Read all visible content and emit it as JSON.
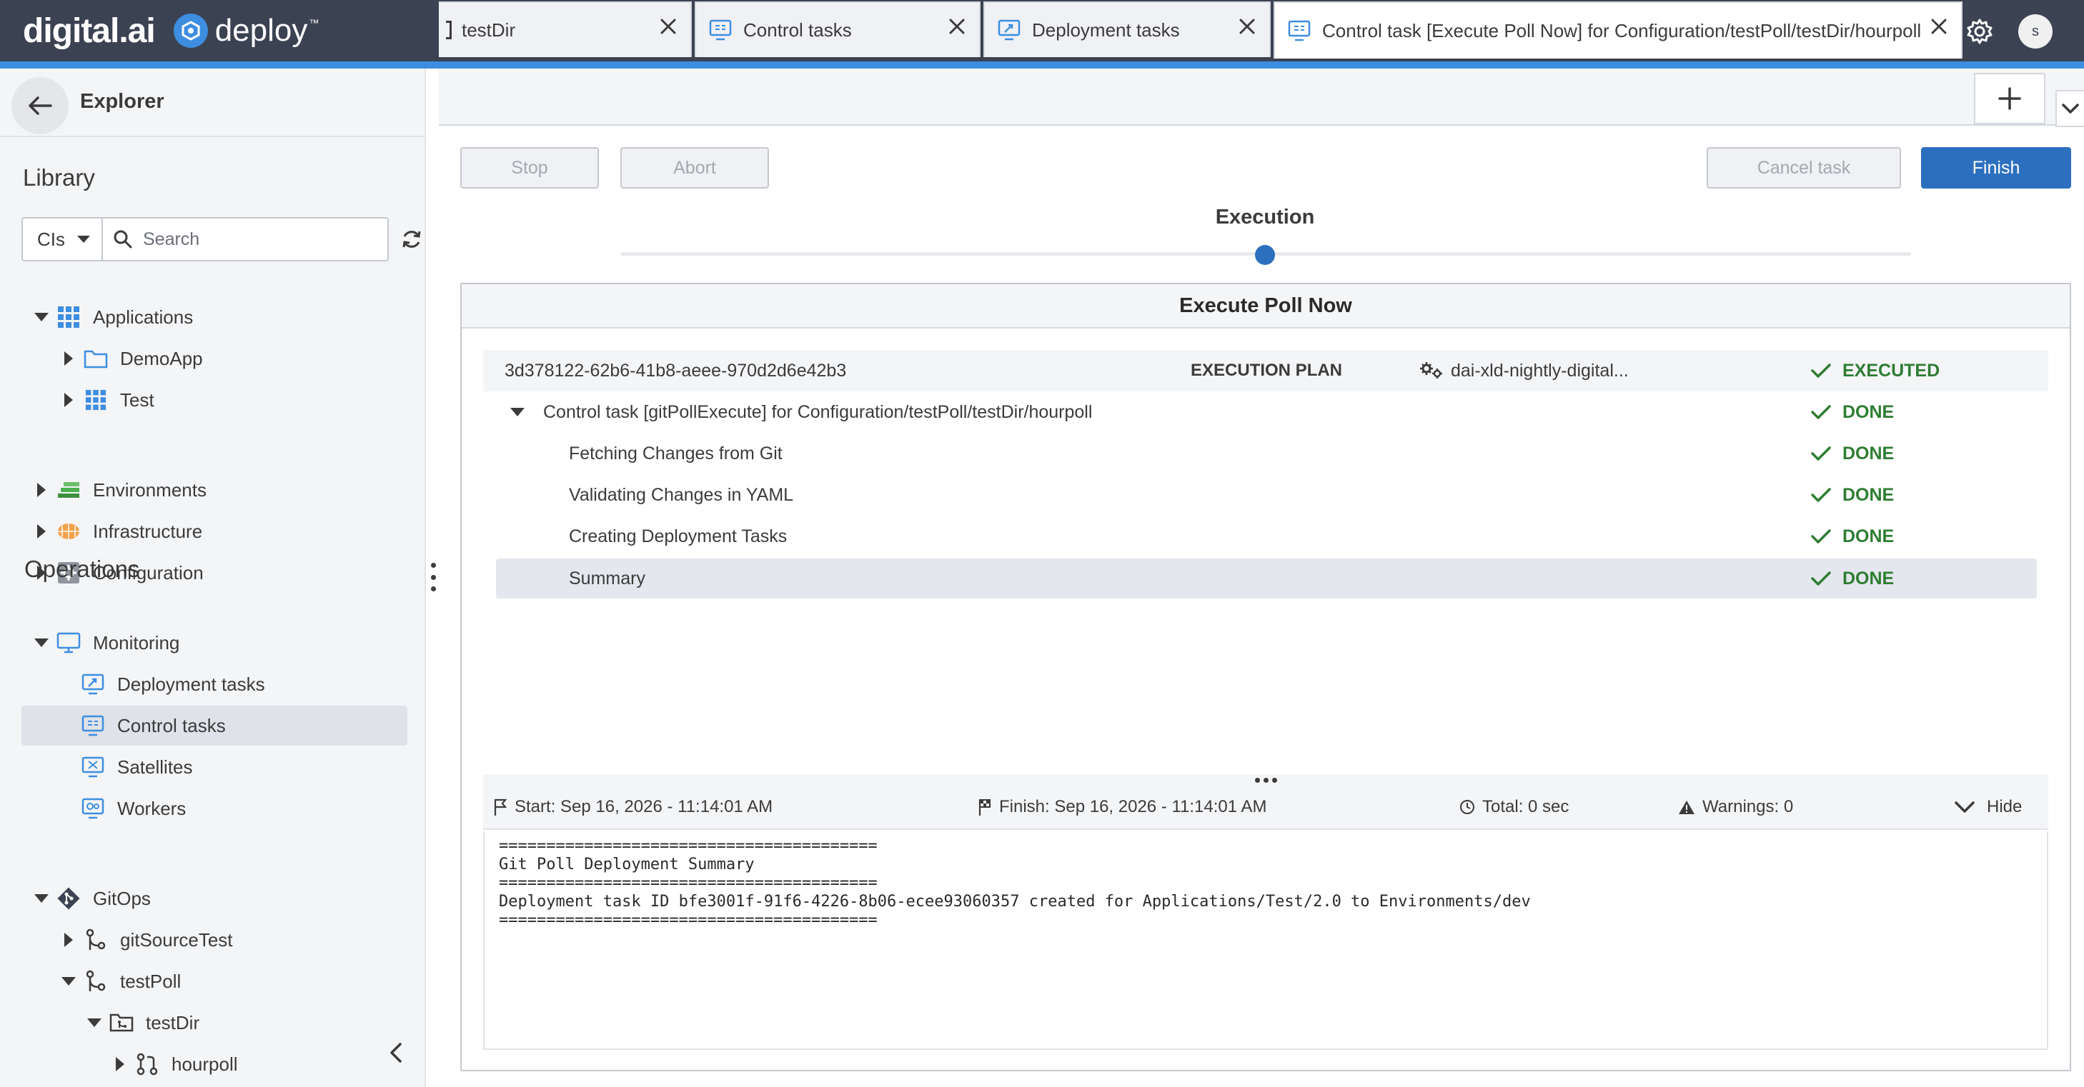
{
  "app": {
    "brand_digital": "digital.ai",
    "brand_product": "deploy",
    "brand_tm": "™",
    "avatar_initial": "s",
    "icons": [
      "help-icon",
      "gear-icon"
    ]
  },
  "sidebar": {
    "title": "Explorer",
    "library_title": "Library",
    "filter_type": "CIs",
    "search_placeholder": "Search",
    "library_items": [
      {
        "label": "Applications",
        "icon": "applications-icon"
      },
      {
        "label": "DemoApp",
        "icon": "folder-icon"
      },
      {
        "label": "Test",
        "icon": "applications-icon"
      },
      {
        "label": "Environments",
        "icon": "environments-icon"
      },
      {
        "label": "Infrastructure",
        "icon": "infrastructure-icon"
      },
      {
        "label": "Configuration",
        "icon": "configuration-icon"
      }
    ],
    "operations_title": "Operations",
    "operations_items": [
      {
        "label": "Monitoring",
        "icon": "monitor-icon"
      },
      {
        "label": "Deployment tasks",
        "icon": "deployment-tasks-icon"
      },
      {
        "label": "Control tasks",
        "icon": "control-tasks-icon"
      },
      {
        "label": "Satellites",
        "icon": "satellites-icon"
      },
      {
        "label": "Workers",
        "icon": "workers-icon"
      },
      {
        "label": "GitOps",
        "icon": "git-icon"
      },
      {
        "label": "gitSourceTest",
        "icon": "git-branch-icon"
      },
      {
        "label": "testPoll",
        "icon": "git-branch-icon"
      },
      {
        "label": "testDir",
        "icon": "git-folder-icon"
      },
      {
        "label": "hourpoll",
        "icon": "git-pull-icon"
      }
    ]
  },
  "tabs": [
    {
      "label": "testDir"
    },
    {
      "label": "Control tasks"
    },
    {
      "label": "Deployment tasks"
    },
    {
      "label": "Control task [Execute Poll Now] for Configuration/testPoll/testDir/hourpoll"
    }
  ],
  "toolbar": {
    "stop": "Stop",
    "abort": "Abort",
    "cancel": "Cancel task",
    "finish": "Finish"
  },
  "stepper": {
    "label": "Execution"
  },
  "task": {
    "title": "Execute Poll Now",
    "id": "3d378122-62b6-41b8-aeee-970d2d6e42b3",
    "plan_label": "EXECUTION PLAN",
    "worker": "dai-xld-nightly-digital...",
    "plan_status": "EXECUTED",
    "block_label": "Control task [gitPollExecute] for Configuration/testPoll/testDir/hourpoll",
    "block_status": "DONE",
    "steps": [
      {
        "label": "Fetching Changes from Git",
        "status": "DONE"
      },
      {
        "label": "Validating Changes in YAML",
        "status": "DONE"
      },
      {
        "label": "Creating Deployment Tasks",
        "status": "DONE"
      },
      {
        "label": "Summary",
        "status": "DONE"
      }
    ],
    "status_color": "#2e7d32"
  },
  "info": {
    "start": "Start: Sep 16, 2026 - 11:14:01 AM",
    "finish": "Finish: Sep 16, 2026 - 11:14:01 AM",
    "total": "Total: 0 sec",
    "warnings": "Warnings: 0",
    "hide": "Hide"
  },
  "log": {
    "lines": [
      "========================================",
      "Git Poll Deployment Summary",
      "========================================",
      "Deployment task ID bfe3001f-91f6-4226-8b06-ecee93060357 created for Applications/Test/2.0 to Environments/dev",
      "========================================"
    ]
  }
}
